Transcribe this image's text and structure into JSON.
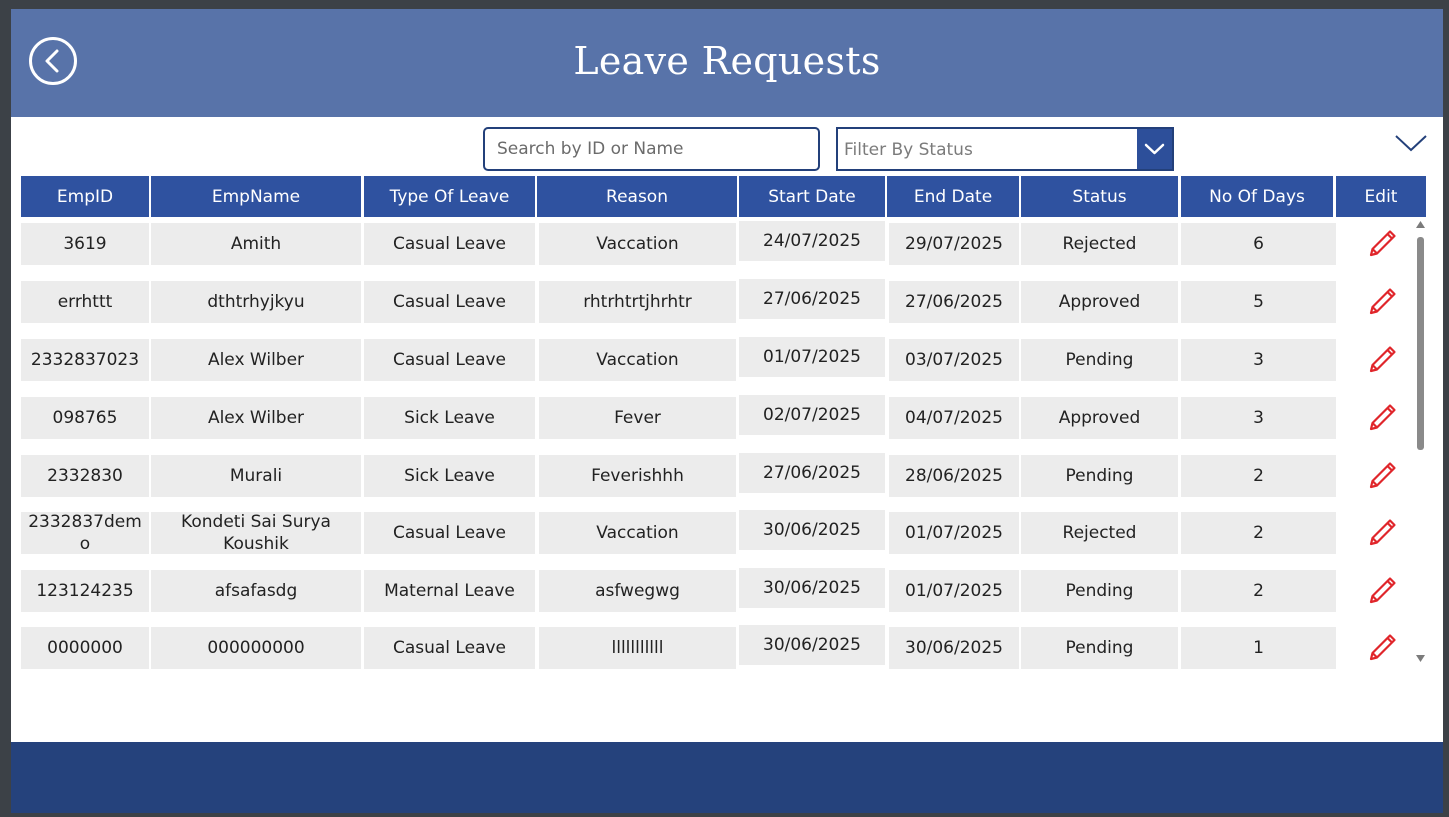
{
  "header": {
    "title": "Leave Requests",
    "back_icon": "chevron-left-circle-icon",
    "background_color": "#5873a9"
  },
  "search": {
    "placeholder": "Search by ID or Name",
    "value": ""
  },
  "filter": {
    "placeholder": "Filter By Status",
    "icon": "chevron-down-icon"
  },
  "table": {
    "columns": [
      "EmpID",
      "EmpName",
      "Type Of Leave",
      "Reason",
      "Start Date",
      "End Date",
      "Status",
      "No Of Days",
      "Edit"
    ],
    "rows": [
      {
        "emp_id": "3619",
        "emp_name": "Amith",
        "leave_type": "Casual Leave",
        "reason": "Vaccation",
        "start_date": "24/07/2025",
        "end_date": "29/07/2025",
        "status": "Rejected",
        "days": "6"
      },
      {
        "emp_id": "errhttt",
        "emp_name": "dthtrhyjkyu",
        "leave_type": "Casual Leave",
        "reason": "rhtrhtrtjhrhtr",
        "start_date": "27/06/2025",
        "end_date": "27/06/2025",
        "status": "Approved",
        "days": "5"
      },
      {
        "emp_id": "2332837023",
        "emp_name": "Alex Wilber",
        "leave_type": "Casual Leave",
        "reason": "Vaccation",
        "start_date": "01/07/2025",
        "end_date": "03/07/2025",
        "status": "Pending",
        "days": "3"
      },
      {
        "emp_id": "098765",
        "emp_name": "Alex Wilber",
        "leave_type": "Sick Leave",
        "reason": "Fever",
        "start_date": "02/07/2025",
        "end_date": "04/07/2025",
        "status": "Approved",
        "days": "3"
      },
      {
        "emp_id": "2332830",
        "emp_name": "Murali",
        "leave_type": "Sick Leave",
        "reason": "Feverishhh",
        "start_date": "27/06/2025",
        "end_date": "28/06/2025",
        "status": "Pending",
        "days": "2"
      },
      {
        "emp_id": "2332837demo",
        "emp_name": "Kondeti Sai Surya Koushik",
        "leave_type": "Casual Leave",
        "reason": "Vaccation",
        "start_date": "30/06/2025",
        "end_date": "01/07/2025",
        "status": "Rejected",
        "days": "2"
      },
      {
        "emp_id": "123124235",
        "emp_name": "afsafasdg",
        "leave_type": "Maternal Leave",
        "reason": "asfwegwg",
        "start_date": "30/06/2025",
        "end_date": "01/07/2025",
        "status": "Pending",
        "days": "2"
      },
      {
        "emp_id": "0000000",
        "emp_name": "000000000",
        "leave_type": "Casual Leave",
        "reason": "lllllllllll",
        "start_date": "30/06/2025",
        "end_date": "30/06/2025",
        "status": "Pending",
        "days": "1"
      }
    ],
    "edit_icon": "pencil-icon",
    "edit_icon_color": "#e0262b",
    "header_color": "#2f52a0"
  },
  "footer": {
    "background_color": "#25427c"
  }
}
